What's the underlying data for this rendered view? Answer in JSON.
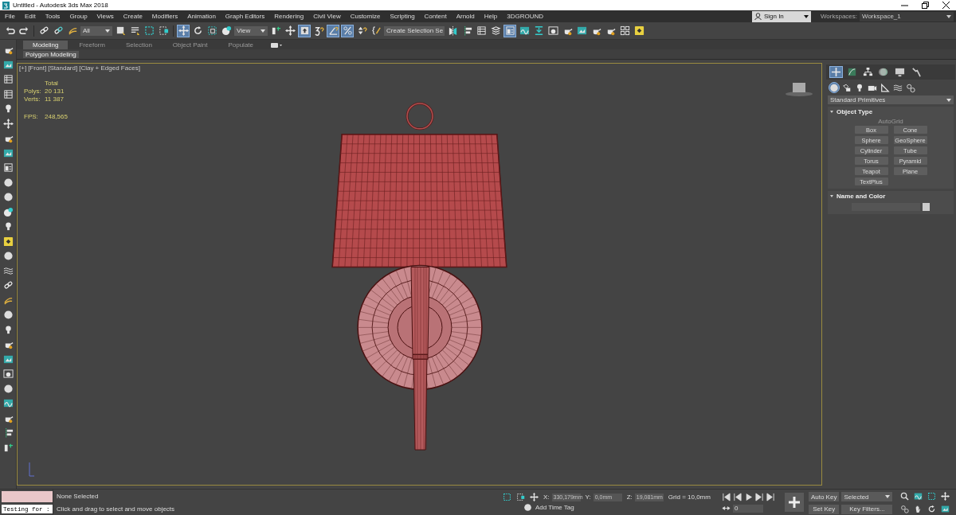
{
  "window": {
    "title": "Untitled - Autodesk 3ds Max 2018"
  },
  "menu": [
    "File",
    "Edit",
    "Tools",
    "Group",
    "Views",
    "Create",
    "Modifiers",
    "Animation",
    "Graph Editors",
    "Rendering",
    "Civil View",
    "Customize",
    "Scripting",
    "Content",
    "Arnold",
    "Help",
    "3DGROUND"
  ],
  "account": {
    "sign_in": "Sign In",
    "workspaces_label": "Workspaces:",
    "workspace": "Workspace_1"
  },
  "main_toolbar": {
    "selection_filter": "All",
    "reference_coordinate": "View",
    "named_selection": "Create Selection Se",
    "group_1": [
      {
        "kind": "undo",
        "active": false
      },
      {
        "kind": "redo",
        "active": false
      },
      {
        "kind": "link",
        "active": false
      },
      {
        "kind": "unlink",
        "active": false
      },
      {
        "kind": "bind",
        "active": false
      }
    ],
    "group_2": [
      {
        "kind": "select",
        "active": false
      },
      {
        "kind": "list",
        "active": false
      },
      {
        "kind": "region",
        "active": false
      },
      {
        "kind": "crossing",
        "active": false
      },
      {
        "kind": "move",
        "active": true
      },
      {
        "kind": "rotate",
        "active": false
      },
      {
        "kind": "scale",
        "active": false
      },
      {
        "kind": "place",
        "active": false
      }
    ],
    "group_3": [
      {
        "kind": "pivot",
        "active": false
      },
      {
        "kind": "move",
        "active": false
      },
      {
        "kind": "manipulate",
        "active": true
      },
      {
        "kind": "snap",
        "active": false
      },
      {
        "kind": "angle",
        "active": true
      },
      {
        "kind": "percent",
        "active": true
      },
      {
        "kind": "spinner",
        "active": false
      },
      {
        "kind": "braces",
        "active": false
      }
    ],
    "group_4": [
      {
        "kind": "mirror",
        "active": false
      },
      {
        "kind": "align",
        "active": false
      },
      {
        "kind": "table",
        "active": false
      },
      {
        "kind": "layers",
        "active": false
      },
      {
        "kind": "ribbon",
        "active": true
      },
      {
        "kind": "curve",
        "active": false
      },
      {
        "kind": "download",
        "active": false
      },
      {
        "kind": "render",
        "active": false
      },
      {
        "kind": "teapot",
        "active": false
      },
      {
        "kind": "frame",
        "active": false
      },
      {
        "kind": "teapot",
        "active": false
      },
      {
        "kind": "teapot",
        "active": false
      },
      {
        "kind": "grid",
        "active": false
      },
      {
        "kind": "star",
        "active": false
      }
    ]
  },
  "ribbon": {
    "tabs": [
      {
        "label": "Modeling",
        "selected": true
      },
      {
        "label": "Freeform",
        "selected": false
      },
      {
        "label": "Selection",
        "selected": false
      },
      {
        "label": "Object Paint",
        "selected": false
      },
      {
        "label": "Populate",
        "selected": false
      }
    ],
    "panel": "Polygon Modeling"
  },
  "viewport": {
    "labels": [
      "[+]",
      "[Front]",
      "[Standard]",
      "[Clay + Edged Faces]"
    ],
    "stats_header": "Total",
    "stats": [
      {
        "label": "Polys:",
        "value": "20 131"
      },
      {
        "label": "Verts:",
        "value": "11 387"
      }
    ],
    "fps": {
      "label": "FPS:",
      "value": "248,565"
    }
  },
  "command_panel": {
    "tabs": [
      {
        "kind": "create",
        "selected": true
      },
      {
        "kind": "modify",
        "selected": false
      },
      {
        "kind": "hierarchy",
        "selected": false
      },
      {
        "kind": "motion",
        "selected": false
      },
      {
        "kind": "display",
        "selected": false
      },
      {
        "kind": "utilities",
        "selected": false
      }
    ],
    "categories": [
      {
        "kind": "geometry",
        "selected": true
      },
      {
        "kind": "shapes",
        "selected": false
      },
      {
        "kind": "lights",
        "selected": false
      },
      {
        "kind": "cameras",
        "selected": false
      },
      {
        "kind": "helpers",
        "selected": false
      },
      {
        "kind": "spacewarps",
        "selected": false
      },
      {
        "kind": "systems",
        "selected": false
      }
    ],
    "dropdown": "Standard Primitives",
    "object_type": {
      "title": "Object Type",
      "expanded": true,
      "autogrid": {
        "label": "AutoGrid",
        "disabled": true
      },
      "buttons": [
        "Box",
        "Cone",
        "Sphere",
        "GeoSphere",
        "Cylinder",
        "Tube",
        "Torus",
        "Pyramid",
        "Teapot",
        "Plane",
        "TextPlus"
      ]
    },
    "name_and_color": {
      "title": "Name and Color",
      "expanded": true
    }
  },
  "status_bar": {
    "listener": "Testing for :",
    "selection": "None Selected",
    "prompt": "Click and drag to select and move objects",
    "coordinates": [
      {
        "axis": "X:",
        "value": "330,179mm"
      },
      {
        "axis": "Y:",
        "value": "0,0mm"
      },
      {
        "axis": "Z:",
        "value": "19,081mm"
      }
    ],
    "grid": "Grid = 10,0mm",
    "time_tag": "Add Time Tag",
    "frame": "0",
    "auto_key": "Auto Key",
    "key_mode": "Selected",
    "set_key": "Set Key",
    "key_filters": "Key Filters..."
  }
}
